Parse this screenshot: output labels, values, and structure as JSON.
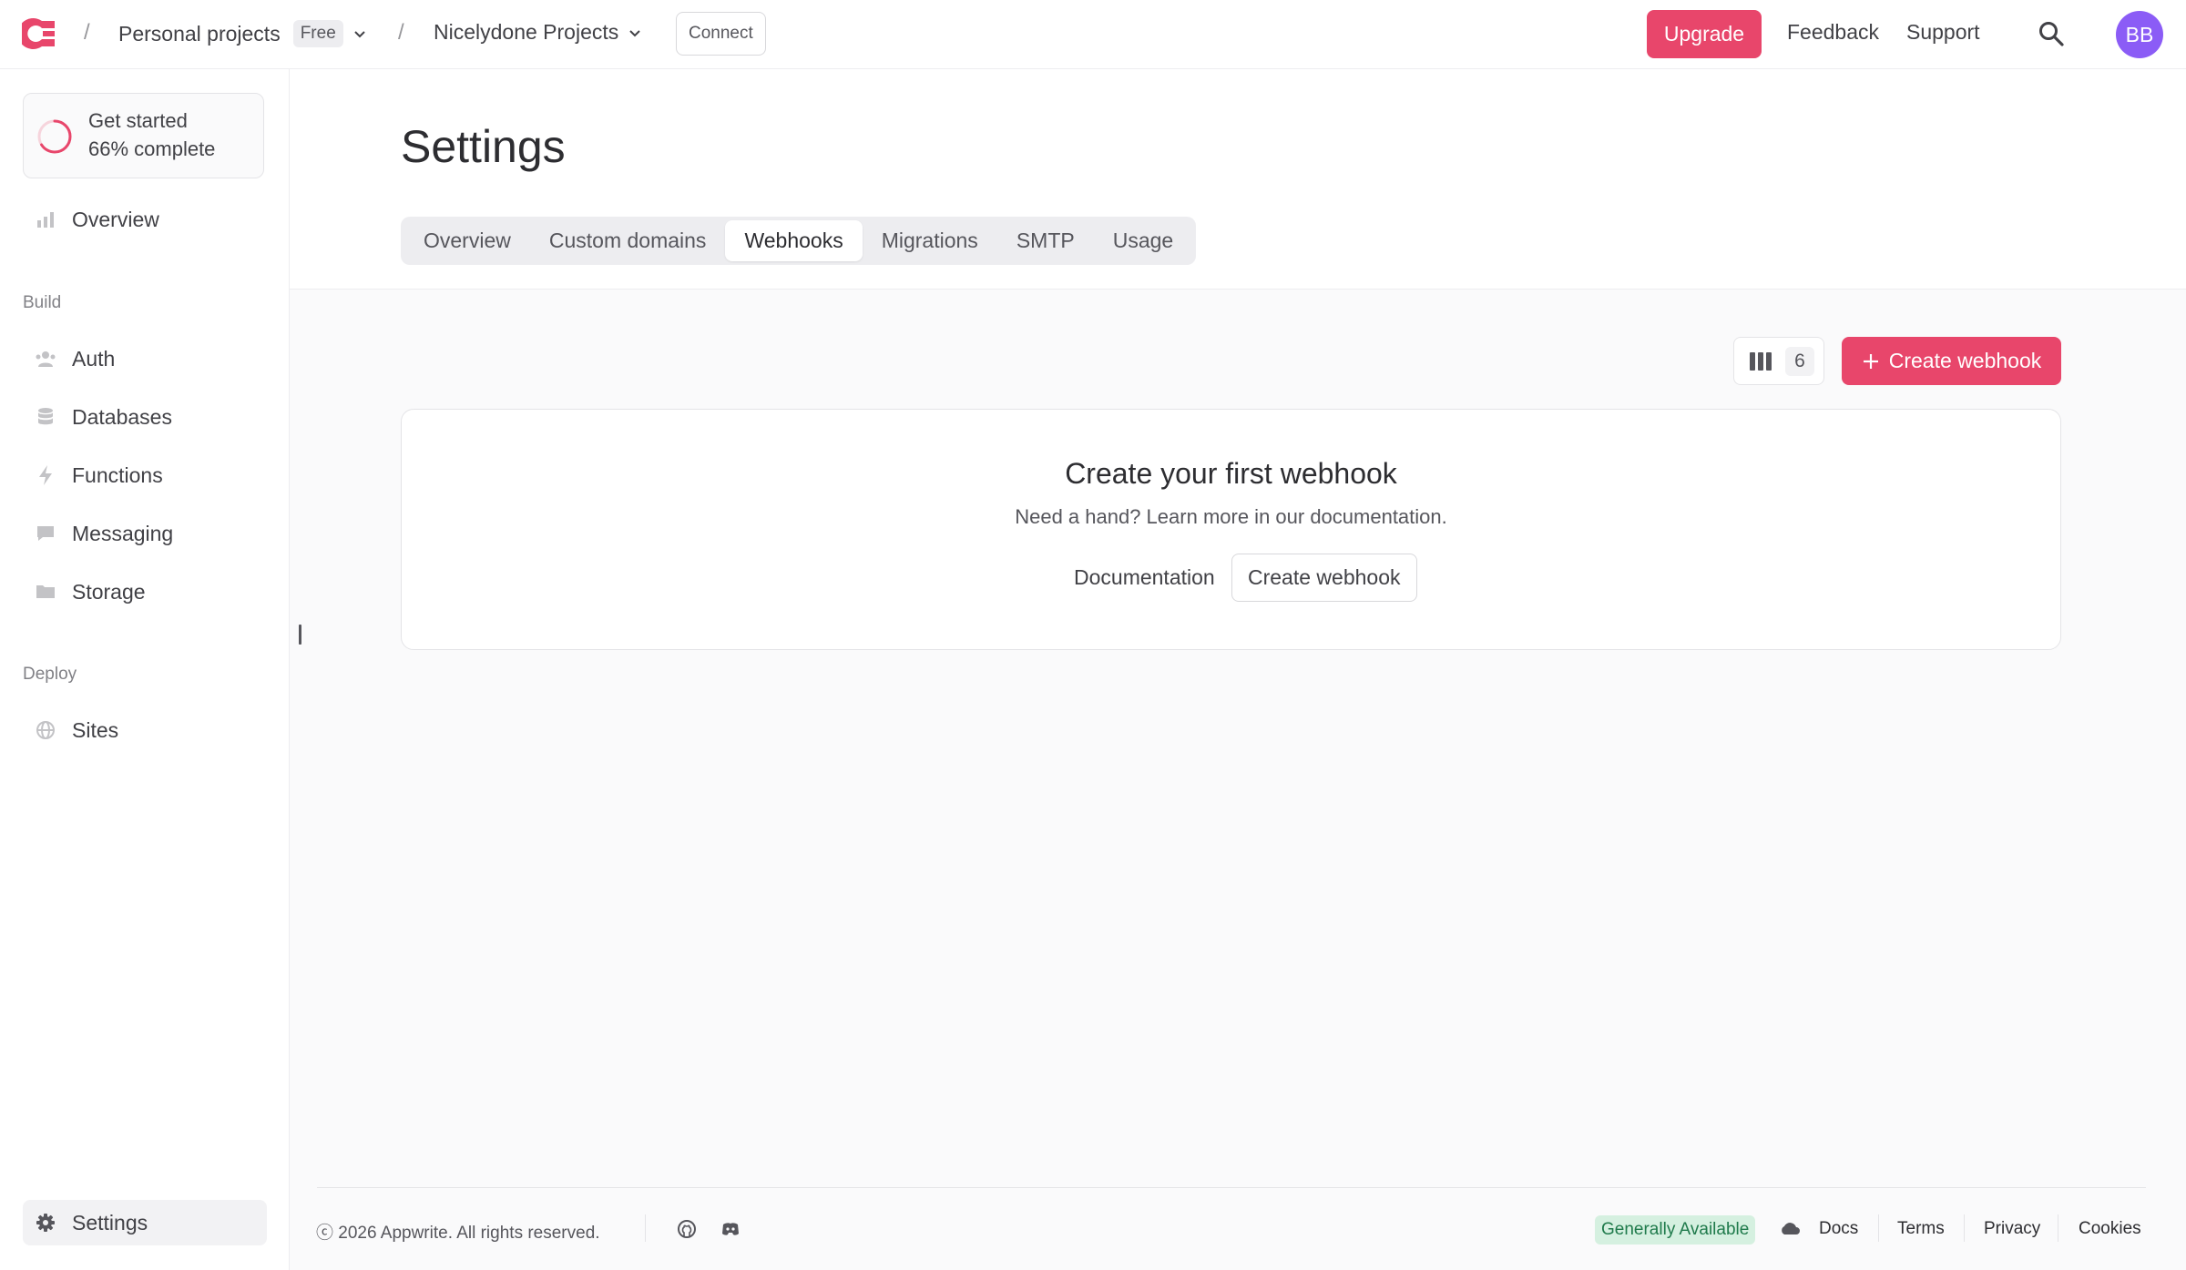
{
  "header": {
    "breadcrumb_org": "Personal projects",
    "org_plan_badge": "Free",
    "breadcrumb_project": "Nicelydone Projects",
    "connect_label": "Connect",
    "upgrade_label": "Upgrade",
    "feedback_label": "Feedback",
    "support_label": "Support",
    "avatar_initials": "BB"
  },
  "sidebar": {
    "progress_title": "Get started",
    "progress_status": "66% complete",
    "progress_value": 66,
    "overview_label": "Overview",
    "build_section": "Build",
    "build_items": [
      "Auth",
      "Databases",
      "Functions",
      "Messaging",
      "Storage"
    ],
    "deploy_section": "Deploy",
    "deploy_items": [
      "Sites"
    ],
    "settings_label": "Settings"
  },
  "main": {
    "title": "Settings",
    "tabs": [
      {
        "label": "Overview",
        "active": false
      },
      {
        "label": "Custom domains",
        "active": false
      },
      {
        "label": "Webhooks",
        "active": true
      },
      {
        "label": "Migrations",
        "active": false
      },
      {
        "label": "SMTP",
        "active": false
      },
      {
        "label": "Usage",
        "active": false
      }
    ],
    "columns_count": "6",
    "create_button": "Create webhook",
    "empty_title": "Create your first webhook",
    "empty_subtitle": "Need a hand? Learn more in our documentation.",
    "documentation_link": "Documentation",
    "empty_create_button": "Create webhook"
  },
  "footer": {
    "copyright": "ⓒ 2026 Appwrite. All rights reserved.",
    "status_badge": "Generally Available",
    "links": [
      "Docs",
      "Terms",
      "Privacy",
      "Cookies"
    ]
  },
  "colors": {
    "accent": "#e8466b",
    "avatar": "#8b5cf6",
    "status_badge_bg": "#d5f0e0"
  },
  "icons": {
    "logo": "appwrite-logo",
    "search": "search-icon",
    "columns": "columns-icon",
    "plus": "plus-icon",
    "github": "github-icon",
    "discord": "discord-icon",
    "cloud": "cloud-icon"
  }
}
